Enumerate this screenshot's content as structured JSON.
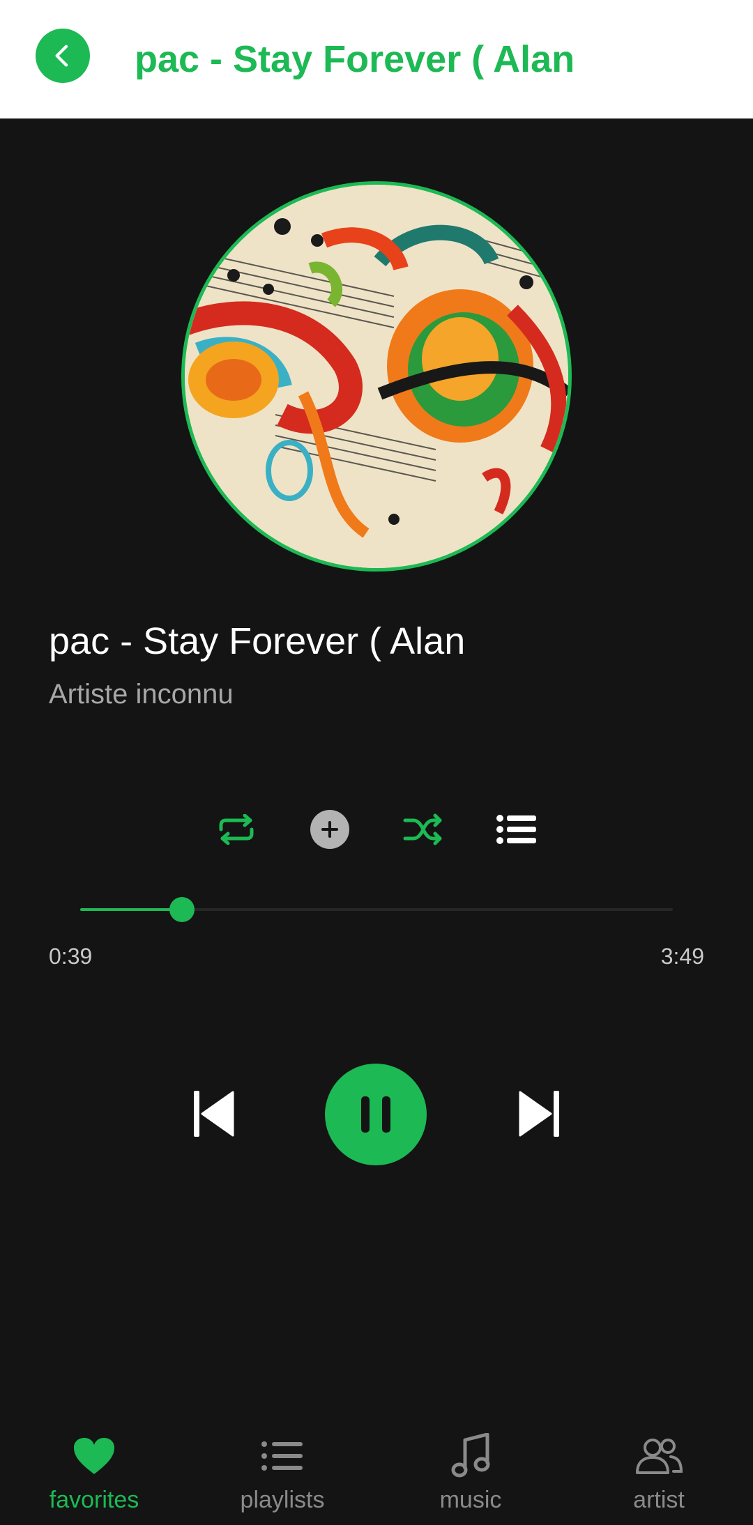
{
  "header": {
    "title": "pac - Stay Forever ( Alan"
  },
  "track": {
    "title": "pac - Stay Forever ( Alan",
    "artist": "Artiste inconnu"
  },
  "playback": {
    "elapsed": "0:39",
    "total": "3:49",
    "progress_fraction": 0.172,
    "state": "playing"
  },
  "nav": {
    "items": [
      {
        "label": "favorites",
        "icon": "heart-icon",
        "active": true
      },
      {
        "label": "playlists",
        "icon": "list-icon",
        "active": false
      },
      {
        "label": "music",
        "icon": "music-note-icon",
        "active": false
      },
      {
        "label": "artist",
        "icon": "people-icon",
        "active": false
      }
    ]
  },
  "colors": {
    "accent": "#1db954",
    "background": "#141414",
    "header_bg": "#ffffff",
    "inactive": "#8a8a8a",
    "secondary_text": "#a7a7a7"
  }
}
